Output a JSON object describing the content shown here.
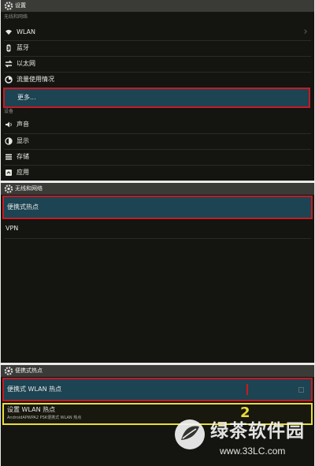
{
  "colors": {
    "accent": "#1d4452",
    "highlight_red": "#c51a25",
    "highlight_yellow": "#e9dc3a"
  },
  "panel1": {
    "title": "设置",
    "section_wireless": "无线和网络",
    "items_wireless": [
      {
        "icon": "wifi-icon",
        "label": "WLAN"
      },
      {
        "icon": "bluetooth-icon",
        "label": "蓝牙"
      },
      {
        "icon": "ethernet-icon",
        "label": "以太网"
      },
      {
        "icon": "data-usage-icon",
        "label": "流量使用情况"
      },
      {
        "icon": "",
        "label": "更多..."
      }
    ],
    "section_device": "设备",
    "items_device": [
      {
        "icon": "sound-icon",
        "label": "声音"
      },
      {
        "icon": "display-icon",
        "label": "显示"
      },
      {
        "icon": "storage-icon",
        "label": "存储"
      },
      {
        "icon": "apps-icon",
        "label": "应用"
      }
    ]
  },
  "panel2": {
    "title": "无线和网络",
    "items": [
      {
        "label": "便携式热点"
      },
      {
        "label": "VPN"
      }
    ]
  },
  "panel3": {
    "title": "便携式热点",
    "hotspot_toggle": {
      "label": "便携式 WLAN 热点",
      "checked": false
    },
    "setup_item": {
      "label": "设置 WLAN 热点",
      "summary": "AndroidAPWPA2 PSK便携式 WLAN 热点"
    },
    "annotation_number": "2"
  },
  "watermark": {
    "brand": "绿茶软件园",
    "url": "www.33LC.com"
  }
}
